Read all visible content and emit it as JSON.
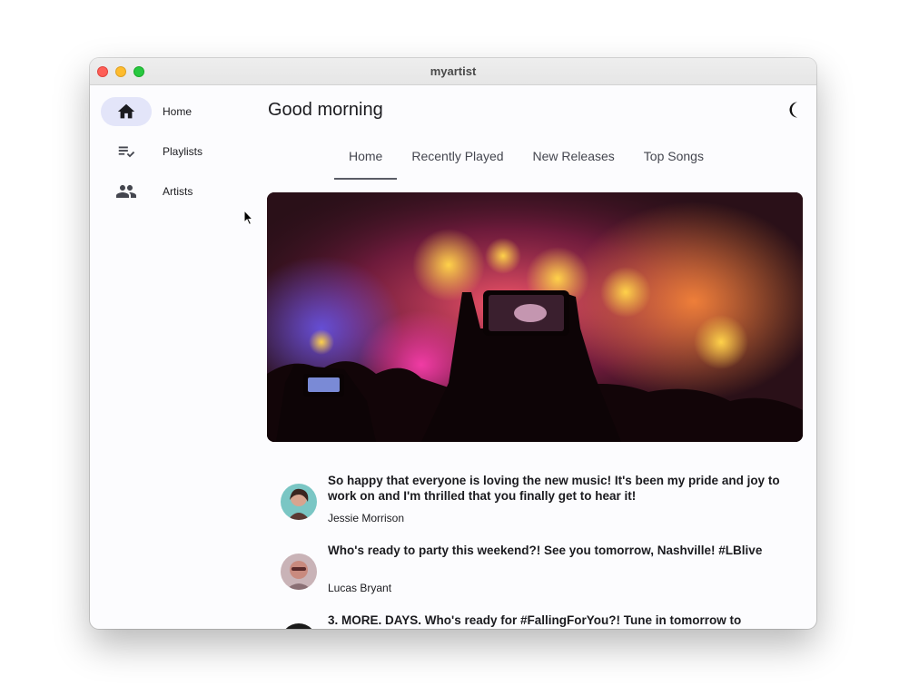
{
  "window": {
    "title": "myartist"
  },
  "sidebar": {
    "items": [
      {
        "label": "Home",
        "icon": "home-icon",
        "active": true
      },
      {
        "label": "Playlists",
        "icon": "playlist-icon",
        "active": false
      },
      {
        "label": "Artists",
        "icon": "people-icon",
        "active": false
      }
    ]
  },
  "header": {
    "greeting": "Good morning",
    "theme_icon": "moon-icon"
  },
  "tabs": [
    {
      "label": "Home",
      "active": true
    },
    {
      "label": "Recently Played",
      "active": false
    },
    {
      "label": "New Releases",
      "active": false
    },
    {
      "label": "Top Songs",
      "active": false
    }
  ],
  "posts": [
    {
      "text": "So happy that everyone is loving the new music! It's been my pride and joy to work on and I'm thrilled that you finally get to hear it!",
      "author": "Jessie Morrison"
    },
    {
      "text": "Who's ready to party this weekend?! See you tomorrow, Nashville! #LBlive",
      "author": "Lucas Bryant"
    },
    {
      "text": "3. MORE. DAYS. Who's ready for #FallingForYou?! Tune in tomorrow to",
      "author": ""
    }
  ],
  "colors": {
    "nav_active_bg": "#e3e5f9",
    "window_bg": "#fcfcfe",
    "tab_indicator": "#5a5c66"
  }
}
